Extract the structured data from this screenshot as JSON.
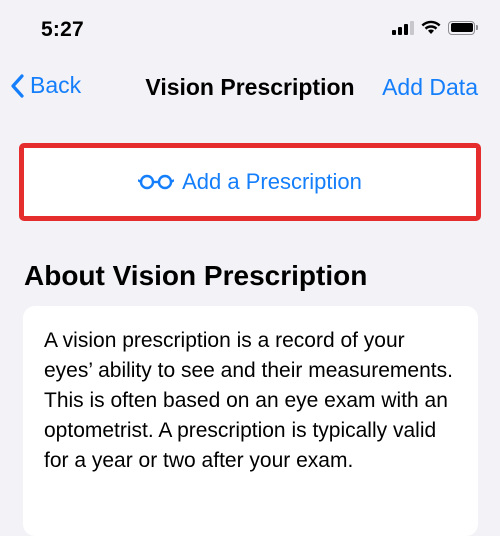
{
  "status_bar": {
    "time": "5:27",
    "icons": [
      "cellular-signal-icon",
      "wifi-icon",
      "battery-icon"
    ]
  },
  "nav": {
    "back_label": "Back",
    "title": "Vision Prescription",
    "add_data_label": "Add Data",
    "back_icon": "chevron-left-icon"
  },
  "add_prescription": {
    "label": "Add a Prescription",
    "icon": "glasses-icon"
  },
  "about": {
    "title": "About Vision Prescription",
    "body": "A vision prescription is a record of your eyes’ ability to see and their measurements. This is often based on an eye exam with an optometrist. A prescription is typically valid for a year or two after your exam."
  },
  "colors": {
    "accent": "#147efb",
    "highlight": "#e52d2d",
    "background": "#f2f2f7"
  }
}
